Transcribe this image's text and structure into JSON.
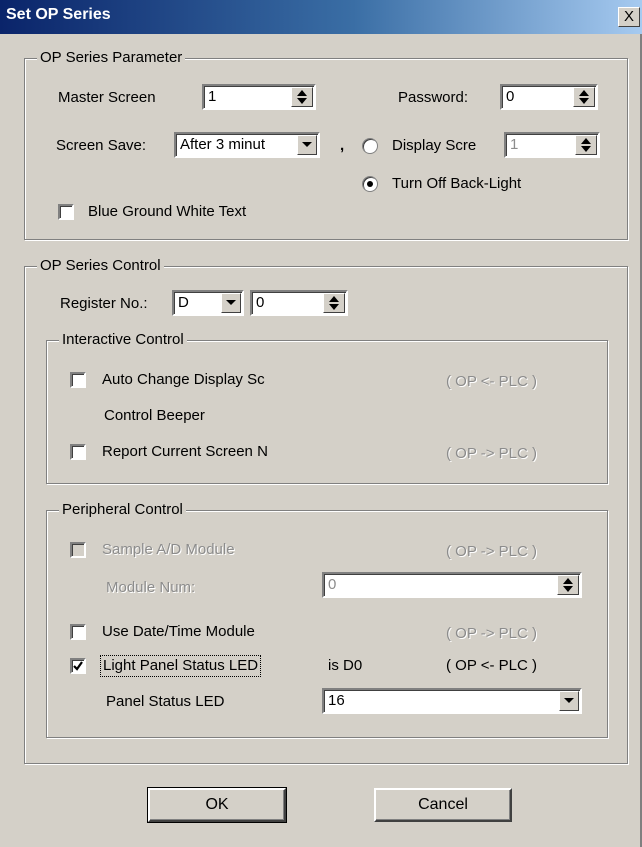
{
  "window": {
    "title": "Set OP Series",
    "close_glyph": "X"
  },
  "op_series_parameter": {
    "legend": "OP Series Parameter",
    "master_screen_label": "Master Screen",
    "master_screen_value": "1",
    "password_label": "Password:",
    "password_value": "0",
    "screen_save_label": "Screen Save:",
    "screen_save_value": "After 3 minut",
    "separator": ",",
    "display_screen_label": "Display Scre",
    "display_screen_value": "1",
    "turn_off_backlight_label": "Turn Off Back-Light",
    "blue_ground_label": "Blue Ground White Text",
    "selected_radio": "turn_off_backlight",
    "blue_ground_checked": false
  },
  "op_series_control": {
    "legend": "OP Series Control",
    "register_label": "Register No.:",
    "register_device": "D",
    "register_value": "0",
    "interactive": {
      "legend": "Interactive Control",
      "auto_change_label": "Auto Change Display Sc",
      "auto_change_checked": false,
      "auto_change_dir": "( OP <- PLC )",
      "control_beeper_label": "Control Beeper",
      "report_label": "Report Current Screen N",
      "report_checked": false,
      "report_dir": "( OP -> PLC )"
    },
    "peripheral": {
      "legend": "Peripheral Control",
      "sample_ad_label": "Sample A/D Module",
      "sample_ad_checked": false,
      "sample_ad_dir": "( OP -> PLC )",
      "module_num_label": "Module Num:",
      "module_num_value": "0",
      "date_time_label": "Use Date/Time Module",
      "date_time_checked": false,
      "date_time_dir": "( OP -> PLC )",
      "light_panel_label": "Light Panel Status LED",
      "light_panel_checked": true,
      "light_panel_is": "is  D0",
      "light_panel_dir": "( OP <- PLC )",
      "panel_status_label": "Panel Status LED",
      "panel_status_value": "16"
    }
  },
  "buttons": {
    "ok": "OK",
    "cancel": "Cancel"
  },
  "colors": {
    "face": "#d4d0c8",
    "title_start": "#0a246a",
    "title_end": "#a6caf0",
    "disabled_text": "#8c8c8c"
  }
}
